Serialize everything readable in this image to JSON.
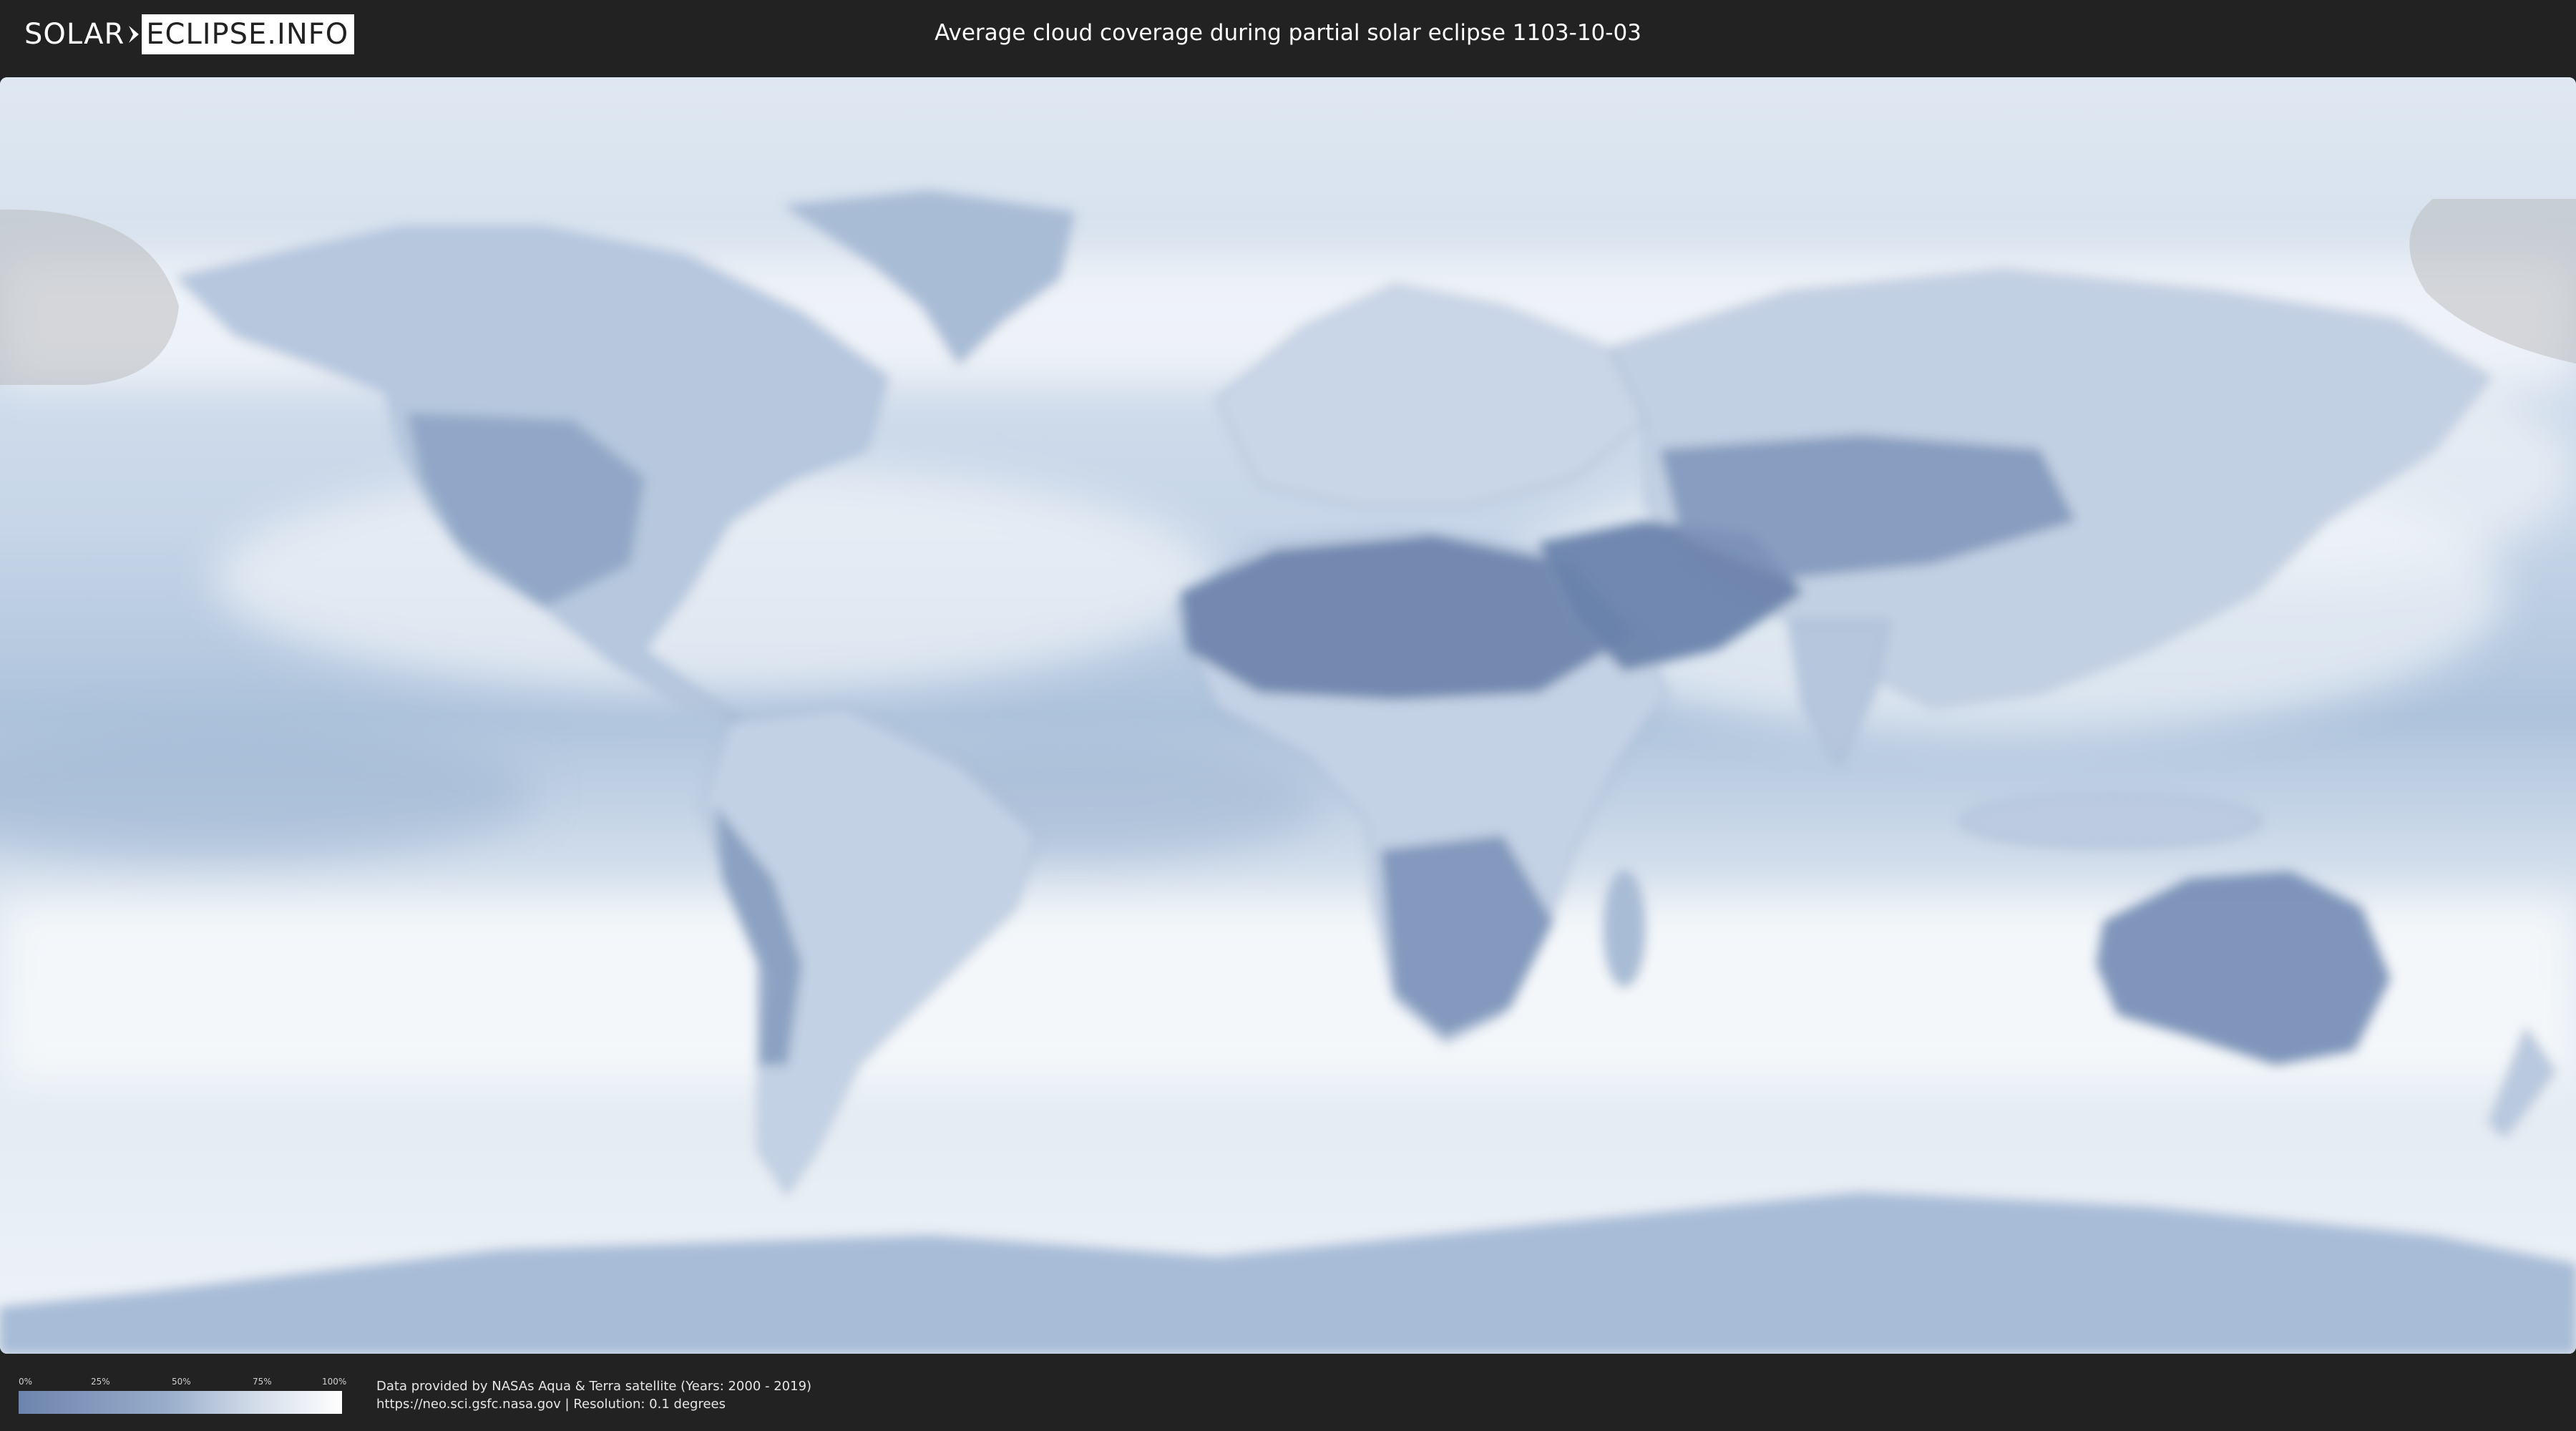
{
  "header": {
    "logo_left": "SOLAR",
    "logo_right": "ECLIPSE.INFO",
    "title": "Average cloud coverage during partial solar eclipse 1103-10-03"
  },
  "legend": {
    "ticks": [
      "0%",
      "25%",
      "50%",
      "75%",
      "100%"
    ],
    "gradient_colors": [
      "#6d84ad",
      "#98acca",
      "#d6dfeb",
      "#ffffff"
    ]
  },
  "footer": {
    "credit_line1": "Data provided by NASAs Aqua & Terra satellite (Years: 2000 - 2019)",
    "credit_line2": "https://neo.sci.gsfc.nasa.gov | Resolution: 0.1 degrees"
  },
  "colors": {
    "background": "#222222",
    "clear_sky": "#6d84ad",
    "cloudy": "#ffffff",
    "eclipse_shade": "#b4b4b4"
  }
}
